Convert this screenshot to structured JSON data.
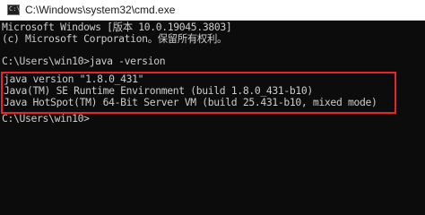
{
  "window": {
    "title": "C:\\Windows\\system32\\cmd.exe",
    "app_icon": "cmd-icon",
    "app_icon_glyph": "C:\\",
    "highlight_color": "#e8232a"
  },
  "console": {
    "lines": [
      "Microsoft Windows [版本 10.0.19045.3803]",
      "(c) Microsoft Corporation。保留所有权利。",
      "",
      "C:\\Users\\win10>java -version"
    ],
    "highlighted_lines": [
      "java version \"1.8.0_431\"",
      "Java(TM) SE Runtime Environment (build 1.8.0_431-b10)",
      "Java HotSpot(TM) 64-Bit Server VM (build 25.431-b10, mixed mode)"
    ],
    "after_lines": [
      "",
      "C:\\Users\\win10>"
    ]
  }
}
